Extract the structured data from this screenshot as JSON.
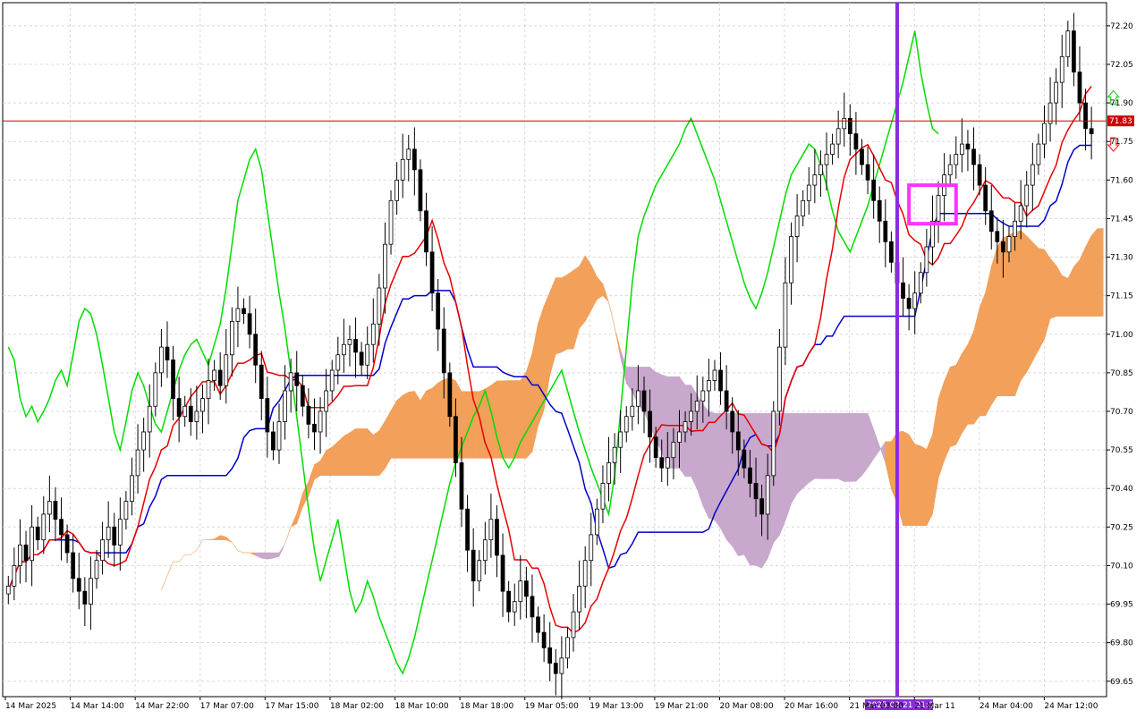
{
  "chart_data": {
    "type": "candlestick",
    "instrument_indicator": "Ichimoku Kinko Hyo",
    "y_axis": {
      "ticks": [
        "72.20",
        "72.05",
        "71.90",
        "71.75",
        "71.60",
        "71.45",
        "71.30",
        "71.15",
        "71.00",
        "70.85",
        "70.70",
        "70.55",
        "70.40",
        "70.25",
        "70.10",
        "69.95",
        "69.80",
        "69.65"
      ],
      "ylim": [
        69.59,
        72.29
      ],
      "current_price_label": "71.83",
      "current_price": 71.83
    },
    "x_axis": {
      "ticks": [
        "14 Mar 2025",
        "14 Mar 14:00",
        "14 Mar 22:00",
        "17 Mar 07:00",
        "17 Mar 15:00",
        "18 Mar 02:00",
        "18 Mar 10:00",
        "18 Mar 18:00",
        "19 Mar 05:00",
        "19 Mar 13:00",
        "19 Mar 21:00",
        "20 Mar 08:00",
        "20 Mar 16:00",
        "21 Mar 03:00",
        "21 Mar 11",
        "24 Mar 04:00",
        "24 Mar 12:00"
      ],
      "highlighted_label": "2025.03.21 21:00",
      "bar_count": 186,
      "vertical_marker_bar": 151
    },
    "candles_close": [
      70.02,
      70.1,
      70.18,
      70.12,
      70.25,
      70.2,
      70.3,
      70.35,
      70.28,
      70.22,
      70.15,
      70.05,
      70.0,
      69.95,
      70.05,
      70.12,
      70.2,
      70.25,
      70.18,
      70.28,
      70.35,
      70.45,
      70.55,
      70.62,
      70.72,
      70.85,
      70.95,
      70.9,
      70.75,
      70.68,
      70.72,
      70.66,
      70.7,
      70.75,
      70.82,
      70.86,
      70.8,
      70.92,
      71.05,
      71.1,
      71.08,
      71.0,
      70.88,
      70.75,
      70.62,
      70.55,
      70.66,
      70.78,
      70.85,
      70.8,
      70.72,
      70.65,
      70.62,
      70.7,
      70.78,
      70.86,
      70.92,
      70.96,
      70.98,
      70.93,
      70.88,
      70.96,
      71.04,
      71.18,
      71.35,
      71.52,
      71.6,
      71.68,
      71.72,
      71.64,
      71.48,
      71.32,
      71.16,
      71.02,
      70.85,
      70.68,
      70.5,
      70.32,
      70.16,
      70.04,
      70.12,
      70.2,
      70.28,
      70.14,
      70.0,
      69.92,
      69.96,
      70.04,
      69.98,
      69.9,
      69.84,
      69.78,
      69.72,
      69.68,
      69.74,
      69.82,
      69.92,
      70.02,
      70.12,
      70.22,
      70.32,
      70.42,
      70.5,
      70.56,
      70.62,
      70.68,
      70.72,
      70.78,
      70.7,
      70.6,
      70.52,
      70.48,
      70.52,
      70.58,
      70.62,
      70.66,
      70.7,
      70.74,
      70.78,
      70.82,
      70.86,
      70.78,
      70.7,
      70.62,
      70.55,
      70.48,
      70.42,
      70.36,
      70.3,
      70.45,
      70.7,
      70.95,
      71.2,
      71.38,
      71.46,
      71.52,
      71.58,
      71.62,
      71.66,
      71.7,
      71.74,
      71.8,
      71.84,
      71.78,
      71.72,
      71.66,
      71.6,
      71.52,
      71.44,
      71.36,
      71.28,
      71.2,
      71.14,
      71.1,
      71.16,
      71.24,
      71.34,
      71.44,
      71.54,
      71.62,
      71.66,
      71.7,
      71.74,
      71.72,
      71.66,
      71.58,
      71.48,
      71.4,
      71.36,
      71.32,
      71.38,
      71.44,
      71.5,
      71.58,
      71.66,
      71.74,
      71.82,
      71.9,
      71.98,
      72.08,
      72.18,
      72.02,
      71.9,
      71.8,
      71.78
    ],
    "series": [
      {
        "name": "Tenkan-sen",
        "color": "#e60000"
      },
      {
        "name": "Kijun-sen",
        "color": "#0000cc"
      },
      {
        "name": "Chikou Span",
        "color": "#00dd00"
      },
      {
        "name": "Senkou Span A",
        "color": "#f2a05a"
      },
      {
        "name": "Senkou Span B",
        "color": "#c8a8cc"
      }
    ],
    "annotations": {
      "vertical_line_color": "#8a2be2",
      "highlight_box_color": "#ff33ff",
      "arrow_up_color": "#33cc33",
      "arrow_down_color": "#ff3333",
      "price_line_color": "#cc0000"
    },
    "grid": true
  }
}
